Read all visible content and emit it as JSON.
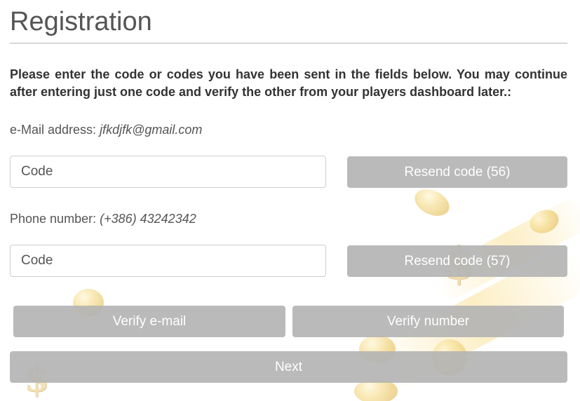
{
  "page": {
    "title": "Registration",
    "instructions": "Please enter the code or codes you have been sent in the fields below. You may continue after entering just one code and verify the other from your players dashboard later.:"
  },
  "email": {
    "label": "e-Mail address:",
    "value": "jfkdjfk@gmail.com",
    "code_placeholder": "Code",
    "resend_label": "Resend code (56)"
  },
  "phone": {
    "label": "Phone number:",
    "value": "(+386) 43242342",
    "code_placeholder": "Code",
    "resend_label": "Resend code (57)"
  },
  "actions": {
    "verify_email_label": "Verify e-mail",
    "verify_number_label": "Verify number",
    "next_label": "Next"
  },
  "colors": {
    "button_bg": "#b4b4b4",
    "text": "#555555",
    "heading_text": "#333333"
  }
}
